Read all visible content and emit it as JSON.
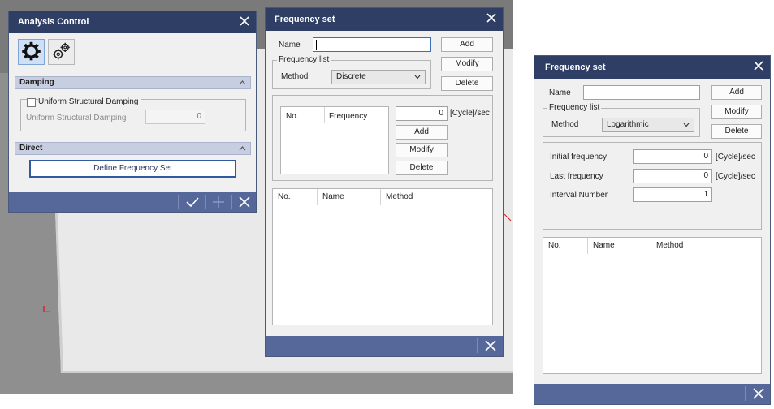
{
  "analysis_control": {
    "title": "Analysis Control",
    "toolbar": {
      "tool1_icon": "gear-icon",
      "tool2_icon": "gears-icon"
    },
    "damping": {
      "header": "Damping",
      "checkbox_label": "Uniform Structural Damping",
      "checked": false,
      "field_label": "Uniform Structural Damping",
      "field_value": "0"
    },
    "direct": {
      "header": "Direct",
      "button_label": "Define Frequency Set"
    },
    "footer": {
      "ok_icon": "check-icon",
      "add_icon": "plus-icon",
      "close_icon": "close-icon"
    }
  },
  "freq_discrete": {
    "title": "Frequency set",
    "name_label": "Name",
    "name_value": "",
    "add_label": "Add",
    "modify_label": "Modify",
    "delete_label": "Delete",
    "freq_list_label": "Frequency list",
    "method_label": "Method",
    "method_value": "Discrete",
    "list_headers": [
      "No.",
      "Frequency"
    ],
    "freq_value": "0",
    "unit": "[Cycle]/sec",
    "list_add": "Add",
    "list_modify": "Modify",
    "list_delete": "Delete",
    "table_headers": [
      "No.",
      "Name",
      "Method"
    ]
  },
  "freq_log": {
    "title": "Frequency set",
    "name_label": "Name",
    "name_value": "",
    "add_label": "Add",
    "modify_label": "Modify",
    "delete_label": "Delete",
    "freq_list_label": "Frequency list",
    "method_label": "Method",
    "method_value": "Logarithmic",
    "initial_label": "Initial frequency",
    "initial_value": "0",
    "last_label": "Last frequency",
    "last_value": "0",
    "interval_label": "Interval Number",
    "interval_value": "1",
    "unit": "[Cycle]/sec",
    "table_headers": [
      "No.",
      "Name",
      "Method"
    ]
  },
  "colors": {
    "title_bar": "#2f3e64",
    "footer": "#56679a",
    "dialog_bg": "#f0f0f0",
    "accent": "#2f5aa0"
  }
}
